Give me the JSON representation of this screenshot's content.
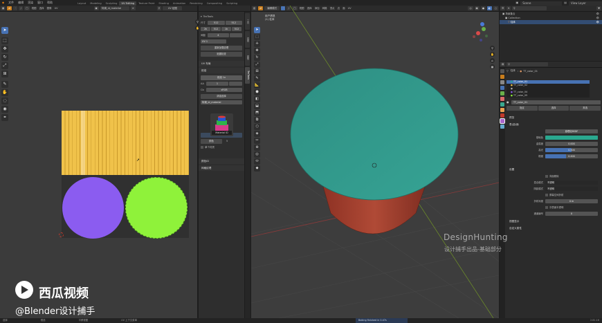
{
  "topbar": {
    "menus": [
      "文件",
      "编辑",
      "渲染",
      "窗口",
      "帮助"
    ],
    "workspaces": [
      {
        "label": "Layout",
        "active": false
      },
      {
        "label": "Modeling",
        "active": false
      },
      {
        "label": "Sculpting",
        "active": false
      },
      {
        "label": "UV Editing",
        "active": true
      },
      {
        "label": "Texture Paint",
        "active": false
      },
      {
        "label": "Shading",
        "active": false
      },
      {
        "label": "Animation",
        "active": false
      },
      {
        "label": "Rendering",
        "active": false
      },
      {
        "label": "Compositing",
        "active": false
      },
      {
        "label": "Scripting",
        "active": false
      }
    ],
    "scene": "Scene",
    "view_layer": "View Layer"
  },
  "uv_editor": {
    "header_menus": [
      "视图",
      "选择",
      "图像",
      "UV"
    ],
    "image_name": "特调_id_material",
    "uv_map_dropdown": "UV 贴图",
    "colors": {
      "yellow": "#f0c24a",
      "purple": "#8b5cf0",
      "green": "#8ff23a"
    },
    "tools": [
      "cursor-arrow",
      "select-box",
      "move",
      "rotate",
      "scale",
      "transform",
      "annotate",
      "grab",
      "relax",
      "pinch",
      "sew"
    ]
  },
  "n_panel": {
    "tab_labels": [
      "工具",
      "视图",
      "图像",
      "TexTools"
    ],
    "title": "TexTools",
    "size_label": "尺寸",
    "size_x": "512",
    "size_y": "512",
    "size_row": [
      "2k",
      "512",
      "1k",
      "512"
    ],
    "padding_label": "间距",
    "padding_value": "4",
    "uv_channel": "UV 1",
    "button_reload": "重新加载纹理",
    "button_checker": "贴图检查",
    "section_uv_layout": "UV 布局",
    "section_bake": "烘焙",
    "bake_button": "烘焙 1x",
    "aa_label": "AA",
    "aa_value": "1",
    "cage_label": "Cb",
    "cage_value": "sRGB",
    "button_bake_sel": "烘焙选择",
    "bake_mode": "特调_id_material",
    "thumb_label": "Material ID",
    "button_tex": "纹理 1x",
    "color_label": "颜色",
    "color_count": "5",
    "checkbox_label": "单个材质",
    "section_colorid": "颜色ID",
    "section_mesh": "网格纹理"
  },
  "viewport": {
    "header_menus": [
      "视图",
      "选择",
      "添加",
      "网格",
      "顶点",
      "边",
      "面",
      "UV"
    ],
    "mode_dropdown": "编辑模式",
    "overlay_line1": "用户透视",
    "overlay_line2": "(1) 柱体",
    "top_face_color": "#2f9a8b",
    "side_color": "#9a3a2a"
  },
  "outliner": {
    "header": "场景集合",
    "rows": [
      {
        "label": "场景集合",
        "selected": false
      },
      {
        "label": "Collection",
        "selected": false
      },
      {
        "label": "柱体",
        "selected": true
      }
    ]
  },
  "properties": {
    "object_label": "柱体",
    "material_name": "TT_color_01",
    "slots": [
      {
        "label": "TT_color_01",
        "selected": true
      },
      {
        "label": "TT_color_02",
        "selected": false
      },
      {
        "label": "",
        "selected": false
      },
      {
        "label": "TT_color_04",
        "selected": false
      },
      {
        "label": "TT_color_05",
        "selected": false
      }
    ],
    "material_field": "TT_color_01",
    "buttons": [
      "指定",
      "选择",
      "弃选"
    ],
    "section_preview": "预览",
    "section_surface": "表(曲)面",
    "surface_value": "原理化BSDF",
    "fields": [
      {
        "label": "基础色",
        "value": "",
        "fill": 1.0,
        "color": "#2aa88f"
      },
      {
        "label": "金属度",
        "value": "0.000",
        "fill": 0.0,
        "color": "#4772b3"
      },
      {
        "label": "高光",
        "value": "0.500",
        "fill": 0.5,
        "color": "#4772b3"
      },
      {
        "label": "糙度",
        "value": "0.400",
        "fill": 0.4,
        "color": "#4772b3"
      }
    ],
    "section_settings": "设置",
    "settings": [
      {
        "label": "",
        "value": "背面剔除",
        "kind": "check"
      },
      {
        "label": "混合模式",
        "value": "不透明",
        "kind": "drop"
      },
      {
        "label": "阴影模式",
        "value": "不透明",
        "kind": "drop"
      },
      {
        "label": "",
        "value": "屏幕空间折射",
        "kind": "check"
      },
      {
        "label": "折射深度",
        "value": "0 m",
        "kind": "num"
      },
      {
        "label": "",
        "value": "次表面半透明",
        "kind": "check"
      },
      {
        "label": "通道编号",
        "value": "0",
        "kind": "num"
      }
    ],
    "section_viewport": "视图显示",
    "section_custom": "自定义属性"
  },
  "statusbar": {
    "items": [
      "选择",
      "框选",
      "平移视图",
      "UV 上下文菜单"
    ],
    "progress_text": "Baking finished in 0.47s",
    "version": "2.81.16"
  },
  "watermarks": {
    "brand": "DesignHunting",
    "brand_sub": "设计捕手出品-基础部分",
    "xigua": "西瓜视频",
    "handle": "@Blender设计捕手"
  }
}
